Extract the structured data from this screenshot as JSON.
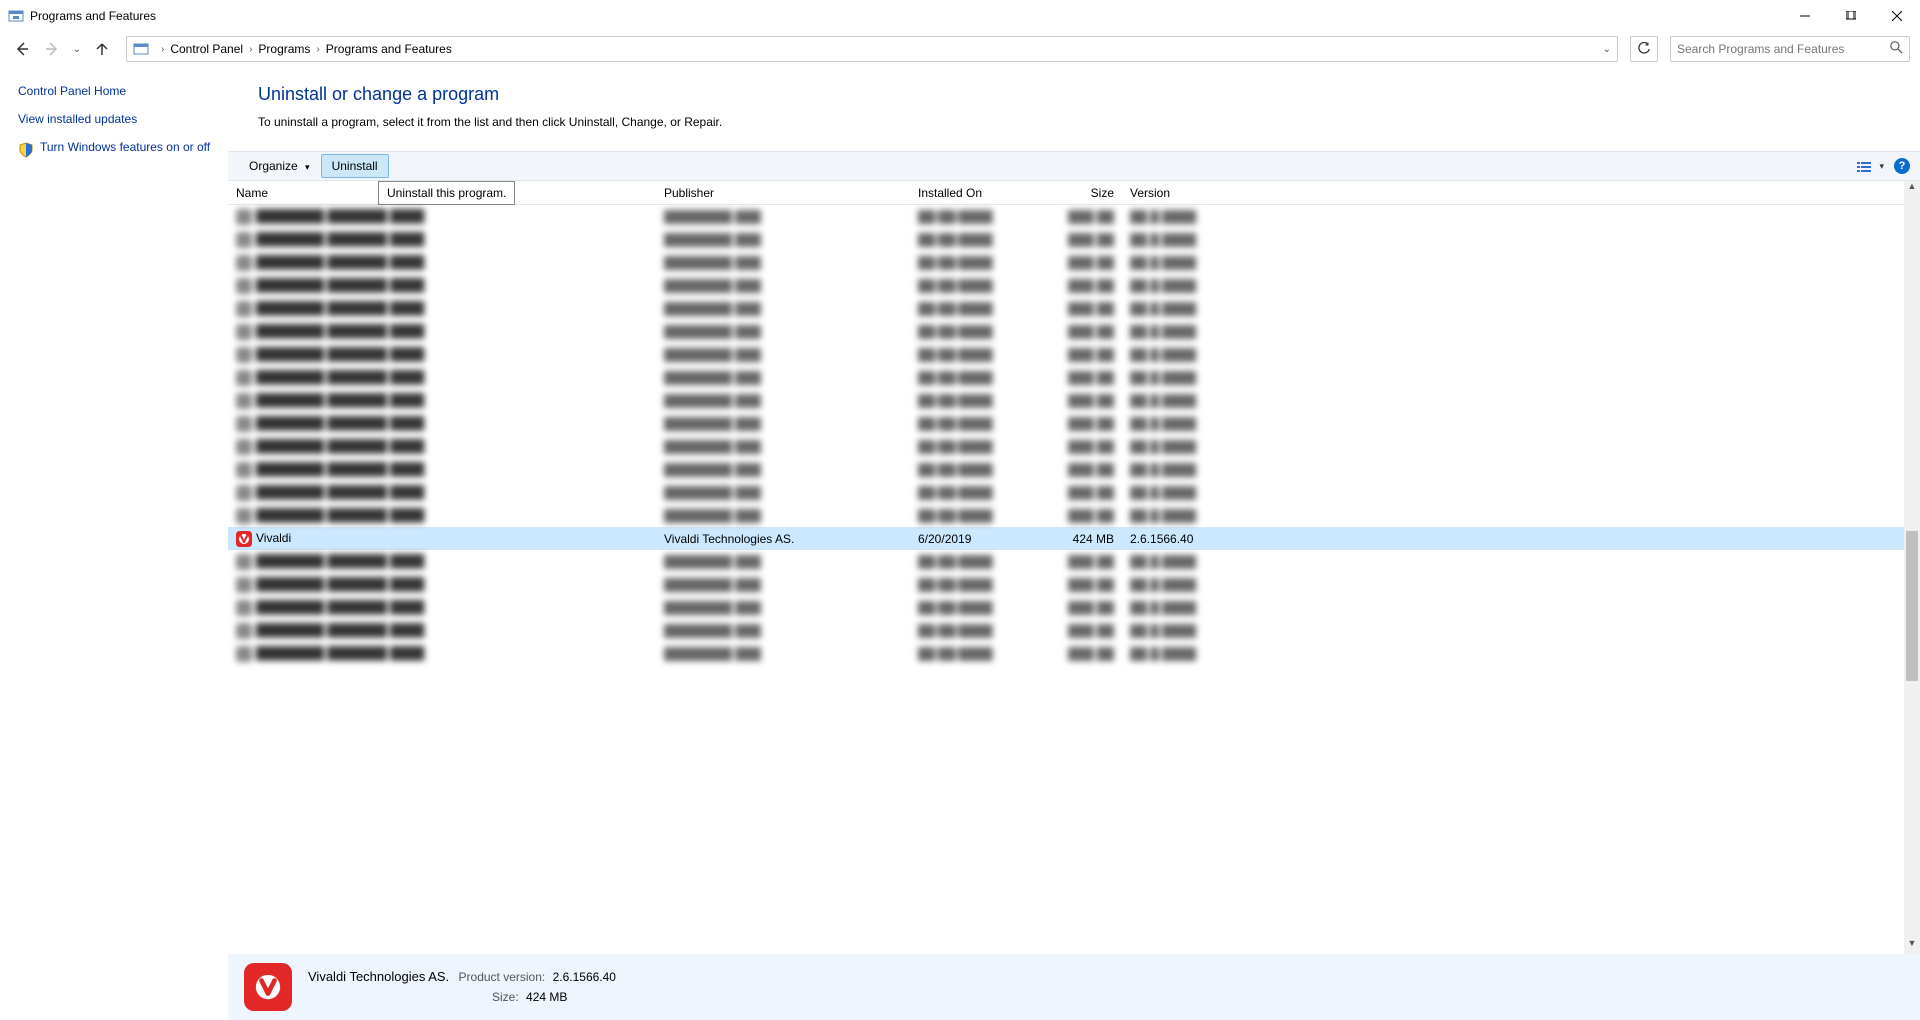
{
  "window": {
    "title": "Programs and Features"
  },
  "breadcrumb": [
    "Control Panel",
    "Programs",
    "Programs and Features"
  ],
  "search": {
    "placeholder": "Search Programs and Features"
  },
  "sidebar": {
    "home": "Control Panel Home",
    "updates": "View installed updates",
    "features": "Turn Windows features on or off"
  },
  "heading": "Uninstall or change a program",
  "subtext": "To uninstall a program, select it from the list and then click Uninstall, Change, or Repair.",
  "toolbar": {
    "organize": "Organize",
    "uninstall": "Uninstall"
  },
  "tooltip": "Uninstall this program.",
  "columns": {
    "name": "Name",
    "publisher": "Publisher",
    "installed": "Installed On",
    "size": "Size",
    "version": "Version"
  },
  "selected": {
    "name": "Vivaldi",
    "publisher": "Vivaldi Technologies AS.",
    "installed": "6/20/2019",
    "size": "424 MB",
    "version": "2.6.1566.40"
  },
  "details": {
    "publisher": "Vivaldi Technologies AS.",
    "pv_label": "Product version:",
    "pv_value": "2.6.1566.40",
    "size_label": "Size:",
    "size_value": "424 MB"
  },
  "blurred_above": 14,
  "blurred_below": 5
}
